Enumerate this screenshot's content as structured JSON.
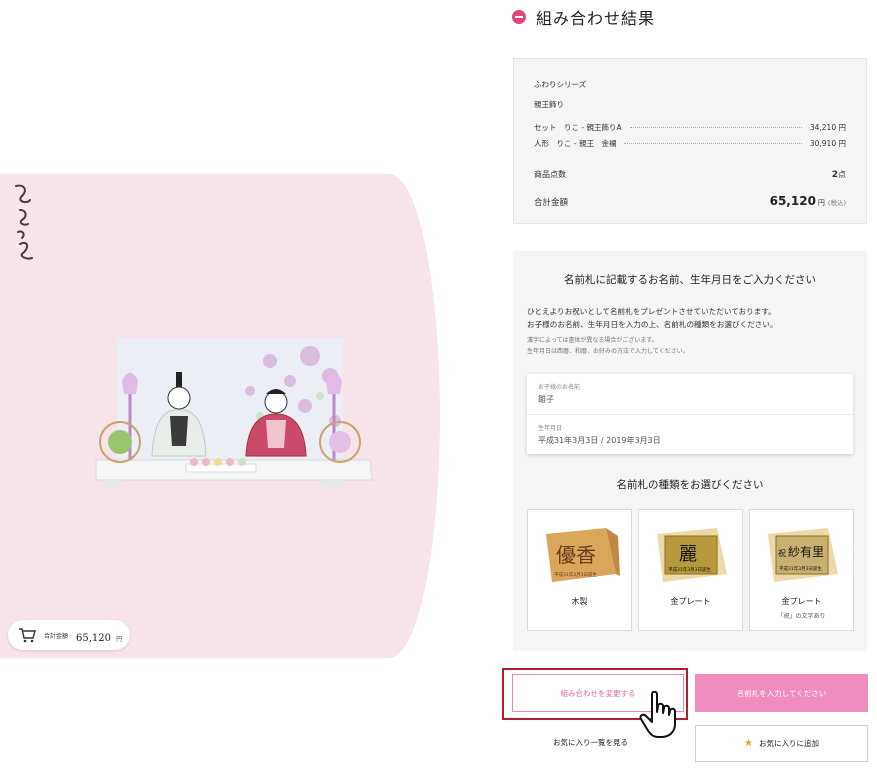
{
  "brand": {
    "logo_text": "ひとえ"
  },
  "cart_pill": {
    "label": "合計金額",
    "amount": "65,120",
    "unit": "円"
  },
  "result": {
    "title": "組み合わせ結果",
    "series": "ふわりシリーズ",
    "category": "親王飾り",
    "items": [
      {
        "label": "セット　りこ - 親王飾りA",
        "price": "34,210 円"
      },
      {
        "label": "人形　りこ - 親王　金襴",
        "price": "30,910 円"
      }
    ],
    "count_label": "商品点数",
    "count_value": "2",
    "count_unit": "点",
    "total_label": "合計金額",
    "total_value": "65,120",
    "total_yen": "円",
    "total_tax": "(税込)"
  },
  "nameplate": {
    "title": "名前札に記載するお名前、生年月日をご入力ください",
    "intro_1": "ひとえよりお祝いとして名前札をプレゼントさせていただいております。",
    "intro_2": "お子様のお名前、生年月日を入力の上、名前札の種類をお選びください。",
    "note_1": "漢字によっては書体が異なる場合がございます。",
    "note_2": "生年月日は西暦、和暦、お好みの方法で入力してください。",
    "name_label": "お子様のお名前",
    "name_placeholder": "雛子",
    "birth_label": "生年月日",
    "birth_placeholder": "平成31年3月3日 / 2019年3月3日",
    "type_title": "名前札の種類をお選びください",
    "options": [
      {
        "name": "木製",
        "note": "",
        "plate_text": "優香",
        "plate_sub": "平成31年3月3日誕生"
      },
      {
        "name": "金プレート",
        "note": "",
        "plate_text": "麗",
        "plate_sub": "平成31年3月3日誕生"
      },
      {
        "name": "金プレート",
        "note": "「祝」の文字あり",
        "plate_text": "紗有里",
        "plate_prefix": "祝",
        "plate_sub": "平成31年3月3日誕生"
      }
    ]
  },
  "actions": {
    "change_label": "組み合わせを変更する",
    "input_label": "名前札を入力してください",
    "favlist_label": "お気に入り一覧を見る",
    "fav_add_label": "お気に入りに追加"
  },
  "colors": {
    "accent_pink": "#e0467d",
    "button_pink": "#ef8dbf",
    "bg_pink": "#f7e3ea",
    "highlight_red": "#b21e2f"
  },
  "icons": [
    "cart-icon",
    "star-icon",
    "hand-cursor-icon",
    "result-dot-icon"
  ]
}
